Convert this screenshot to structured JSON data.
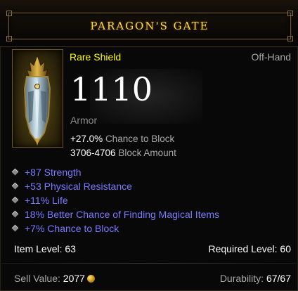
{
  "item": {
    "name": "PARAGON'S GATE",
    "type": "Rare Shield",
    "slot": "Off-Hand",
    "armor": "1110",
    "armor_label": "Armor",
    "base_stats": [
      {
        "value": "+27.0%",
        "label": "Chance to Block"
      },
      {
        "value": "3706-4706",
        "label": "Block Amount"
      }
    ],
    "affixes": [
      "+87 Strength",
      "+53 Physical Resistance",
      "+11% Life",
      "18% Better Chance of Finding Magical Items",
      "+7% Chance to Block"
    ],
    "item_level_label": "Item Level:",
    "item_level": "63",
    "required_level_label": "Required Level:",
    "required_level": "60",
    "sell_label": "Sell Value:",
    "sell_value": "2077",
    "durability_label": "Durability:",
    "durability": "67/67"
  },
  "colors": {
    "title": "#ffd64a",
    "rare": "#ffff00",
    "magic_affix": "#7a7aff",
    "slot": "#a8a8a8"
  },
  "icons": [
    "shield-item-icon",
    "gold-coin-icon",
    "affix-bullet-icon"
  ]
}
